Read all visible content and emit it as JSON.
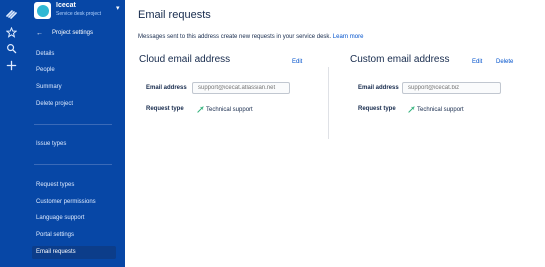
{
  "rail": {
    "icons": [
      "jira-logo-icon",
      "star-icon",
      "search-icon",
      "plus-icon"
    ]
  },
  "project": {
    "name": "Icecat",
    "type": "Service desk project"
  },
  "sidebar": {
    "back_label": "Project settings",
    "group1": [
      {
        "label": "Details"
      },
      {
        "label": "People"
      },
      {
        "label": "Summary"
      },
      {
        "label": "Delete project"
      }
    ],
    "group2": [
      {
        "label": "Issue types"
      }
    ],
    "group3": [
      {
        "label": "Request types"
      },
      {
        "label": "Customer permissions"
      },
      {
        "label": "Language support"
      },
      {
        "label": "Portal settings"
      },
      {
        "label": "Email requests",
        "active": true
      }
    ]
  },
  "main": {
    "title": "Email requests",
    "intro_text": "Messages sent to this address create new requests in your service desk.",
    "learn_more": "Learn more",
    "cloud": {
      "title": "Cloud email address",
      "edit": "Edit",
      "email_label": "Email address",
      "email_placeholder": "support@icecat.atlassian.net",
      "request_type_label": "Request type",
      "request_type_value": "Technical support"
    },
    "custom": {
      "title": "Custom email address",
      "edit": "Edit",
      "delete": "Delete",
      "email_label": "Email address",
      "email_placeholder": "support@icecat.biz",
      "request_type_label": "Request type",
      "request_type_value": "Technical support"
    }
  },
  "colors": {
    "sidebar_bg": "#0747a6",
    "link": "#0052cc",
    "text": "#172b4d"
  }
}
